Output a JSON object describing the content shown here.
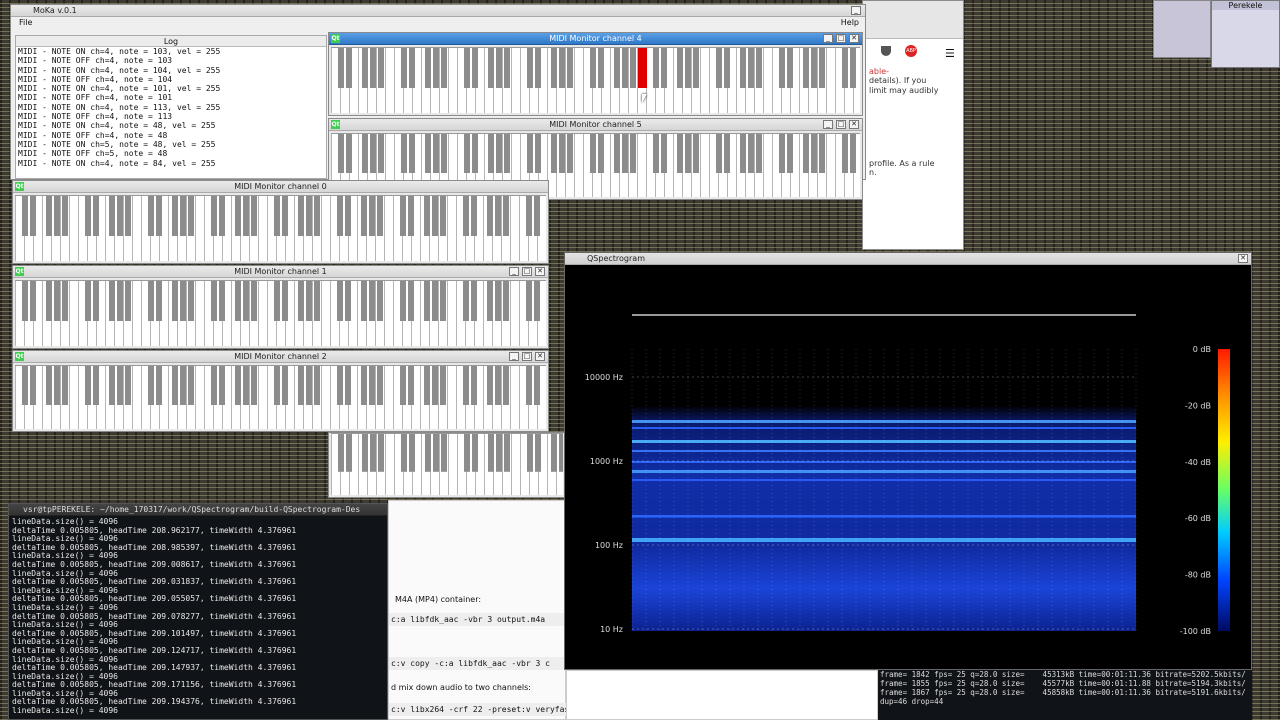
{
  "moka": {
    "title": "MoKa v.0.1",
    "menu_file": "File",
    "menu_help": "Help",
    "log_header": "Log",
    "log_lines": [
      "MIDI - NOTE ON ch=4, note = 103, vel = 255",
      "MIDI - NOTE OFF ch=4, note = 103",
      "MIDI - NOTE ON ch=4, note = 104, vel = 255",
      "MIDI - NOTE OFF ch=4, note = 104",
      "MIDI - NOTE ON ch=4, note = 101, vel = 255",
      "MIDI - NOTE OFF ch=4, note = 101",
      "MIDI - NOTE ON ch=4, note = 113, vel = 255",
      "MIDI - NOTE OFF ch=4, note = 113",
      "MIDI - NOTE ON ch=4, note = 48, vel = 255",
      "MIDI - NOTE OFF ch=4, note = 48",
      "MIDI - NOTE ON ch=5, note = 48, vel = 255",
      "MIDI - NOTE OFF ch=5, note = 48",
      "MIDI - NOTE ON ch=4, note = 84, vel = 255"
    ]
  },
  "monitors": {
    "ch4": "MIDI Monitor channel 4",
    "ch5": "MIDI Monitor channel 5",
    "ch0": "MIDI Monitor channel 0",
    "ch1": "MIDI Monitor channel 1",
    "ch2": "MIDI Monitor channel 2",
    "qt_badge": "Qt",
    "minimize": "_",
    "maximize": "□",
    "close": "✕"
  },
  "browser": {
    "line1": "able-",
    "line2": "details). If you",
    "line3": "limit may audibly",
    "line4": "profile. As a rule",
    "line5": "n.",
    "doc1": "M4A (MP4) container:",
    "doc2": "c:a libfdk_aac -vbr 3 output.m4a",
    "doc3": "c:v copy -c:a libfdk_aac -vbr 3 c",
    "doc4": "d mix down audio to two channels:",
    "doc5": "c:v libx264 -crf 22 -preset:v veryfast \\",
    "abp": "ABP"
  },
  "spectrogram": {
    "title": "QSpectrogram",
    "freq_labels": [
      "10000 Hz",
      "1000 Hz",
      "100 Hz",
      "10 Hz"
    ],
    "db_labels": [
      "0 dB",
      "-20 dB",
      "-40 dB",
      "-60 dB",
      "-80 dB",
      "-100 dB"
    ]
  },
  "terminal": {
    "title": "vsr@tpPEREKELE: ~/home_170317/work/QSpectrogram/build-QSpectrogram-Des",
    "lines": [
      "lineData.size() = 4096",
      "deltaTime 0.005805, headTime 208.962177, timeWidth 4.376961",
      "lineData.size() = 4096",
      "deltaTime 0.005805, headTime 208.985397, timeWidth 4.376961",
      "lineData.size() = 4096",
      "deltaTime 0.005805, headTime 209.008617, timeWidth 4.376961",
      "lineData.size() = 4096",
      "deltaTime 0.005805, headTime 209.031837, timeWidth 4.376961",
      "lineData.size() = 4096",
      "deltaTime 0.005805, headTime 209.055057, timeWidth 4.376961",
      "lineData.size() = 4096",
      "deltaTime 0.005805, headTime 209.078277, timeWidth 4.376961",
      "lineData.size() = 4096",
      "deltaTime 0.005805, headTime 209.101497, timeWidth 4.376961",
      "lineData.size() = 4096",
      "deltaTime 0.005805, headTime 209.124717, timeWidth 4.376961",
      "lineData.size() = 4096",
      "deltaTime 0.005805, headTime 209.147937, timeWidth 4.376961",
      "lineData.size() = 4096",
      "deltaTime 0.005805, headTime 209.171156, timeWidth 4.376961",
      "lineData.size() = 4096",
      "deltaTime 0.005805, headTime 209.194376, timeWidth 4.376961",
      "lineData.size() = 4096"
    ]
  },
  "ffmpeg": {
    "lines": [
      "frame= 1842 fps= 25 q=28.0 size=    45313kB time=00:01:11.36 bitrate=5202.5kbits/",
      "frame= 1855 fps= 25 q=28.0 size=    45577kB time=00:01:11.88 bitrate=5194.3kbits/",
      "frame= 1867 fps= 25 q=28.0 size=    45858kB time=00:01:11.36 bitrate=5191.6kbits/",
      "dup=46 drop=44"
    ]
  },
  "desktop": {
    "user_panel": "Perekele"
  },
  "colors": {
    "active_key": "#e00000",
    "titlebar_active": "#2f78c8",
    "qt_green": "#41cd52"
  }
}
